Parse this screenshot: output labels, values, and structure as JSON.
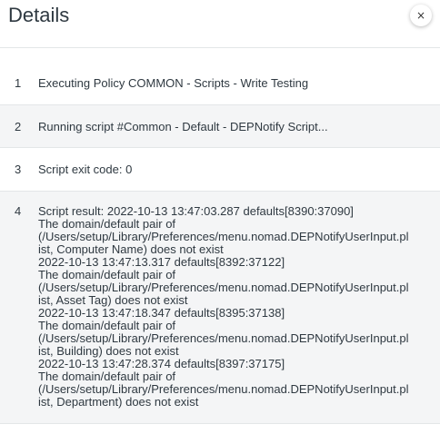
{
  "header": {
    "title": "Details",
    "close_glyph": "×"
  },
  "rows": [
    {
      "num": "1",
      "text": "Executing Policy COMMON - Scripts - Write Testing"
    },
    {
      "num": "2",
      "text": "Running script #Common - Default - DEPNotify Script..."
    },
    {
      "num": "3",
      "text": "Script exit code: 0"
    },
    {
      "num": "4",
      "lines": [
        "Script result: 2022-10-13 13:47:03.287 defaults[8390:37090]",
        "The domain/default pair of",
        "(/Users/setup/Library/Preferences/menu.nomad.DEPNotifyUserInput.pl",
        "ist, Computer Name) does not exist",
        "2022-10-13 13:47:13.317 defaults[8392:37122]",
        "The domain/default pair of",
        "(/Users/setup/Library/Preferences/menu.nomad.DEPNotifyUserInput.pl",
        "ist, Asset Tag) does not exist",
        "2022-10-13 13:47:18.347 defaults[8395:37138]",
        "The domain/default pair of",
        "(/Users/setup/Library/Preferences/menu.nomad.DEPNotifyUserInput.pl",
        "ist, Building) does not exist",
        "2022-10-13 13:47:28.374 defaults[8397:37175]",
        "The domain/default pair of",
        "(/Users/setup/Library/Preferences/menu.nomad.DEPNotifyUserInput.pl",
        "ist, Department) does not exist"
      ]
    }
  ]
}
